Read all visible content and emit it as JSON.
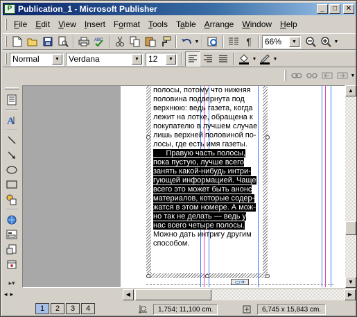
{
  "window": {
    "title": "Publication_1 - Microsoft Publisher",
    "app_icon_glyph": "P",
    "controls": {
      "minimize": "_",
      "maximize": "□",
      "close": "✕"
    }
  },
  "menu": [
    {
      "label": "File",
      "accel": "F"
    },
    {
      "label": "Edit",
      "accel": "E"
    },
    {
      "label": "View",
      "accel": "V"
    },
    {
      "label": "Insert",
      "accel": "I"
    },
    {
      "label": "Format",
      "accel": "o"
    },
    {
      "label": "Tools",
      "accel": "T"
    },
    {
      "label": "Table",
      "accel": "a"
    },
    {
      "label": "Arrange",
      "accel": "A"
    },
    {
      "label": "Window",
      "accel": "W"
    },
    {
      "label": "Help",
      "accel": "H"
    }
  ],
  "standard_toolbar": {
    "zoom": "66%",
    "icons": [
      "new-icon",
      "open-icon",
      "save-icon",
      "print-preview-icon",
      "print-icon",
      "spelling-icon",
      "cut-icon",
      "copy-icon",
      "paste-icon",
      "format-painter-icon",
      "undo-icon",
      "insert-picture-icon",
      "columns-icon",
      "paragraph-mark-icon",
      "zoom-out-icon",
      "zoom-in-icon"
    ]
  },
  "formatting_toolbar": {
    "style": "Normal",
    "font": "Verdana",
    "size": "12"
  },
  "document": {
    "lines": [
      {
        "text": "полосы, потому что нижняя",
        "hl": false
      },
      {
        "text": "половина подвернута под",
        "hl": false
      },
      {
        "text": "верхнюю: ведь газета, когда",
        "hl": false
      },
      {
        "text": "лежит на лотке, обращена к",
        "hl": false
      },
      {
        "text": "покупателю в лучшем случае",
        "hl": false
      },
      {
        "text": "лишь верхней половиной по-",
        "hl": false
      },
      {
        "text": "лосы, где есть имя газеты.",
        "hl": false
      },
      {
        "text": "      Правую часть полосы,",
        "hl": true
      },
      {
        "text": "пока пустую, лучше всего",
        "hl": true
      },
      {
        "text": "занять какой-нибудь интри-",
        "hl": true
      },
      {
        "text": "гующей информацией. Чаще",
        "hl": true
      },
      {
        "text": "всего это может быть анонс",
        "hl": true
      },
      {
        "text": "материалов, которые содер-",
        "hl": true
      },
      {
        "text": "жатся в этом номере. А мож-",
        "hl": true
      },
      {
        "text": "но так не делать — ведь у",
        "hl": true
      },
      {
        "text": "нас всего четыре полосы.",
        "hl": true
      },
      {
        "text": "Можно дать интригу другим",
        "hl": false
      },
      {
        "text": "способом.",
        "hl": false
      }
    ]
  },
  "page_nav": {
    "pages": [
      "1",
      "2",
      "3",
      "4"
    ],
    "selected": "1"
  },
  "status": {
    "position": "1,754; 11,100 cm.",
    "size": "6,745 x 15,843 cm."
  },
  "colors": {
    "title_gradient_start": "#0a246a",
    "title_gradient_end": "#a6caf0",
    "chrome": "#d4d0c8",
    "workspace": "#a8a8a8",
    "guide_blue": "#3c78ff",
    "guide_pink": "#e040a0"
  }
}
